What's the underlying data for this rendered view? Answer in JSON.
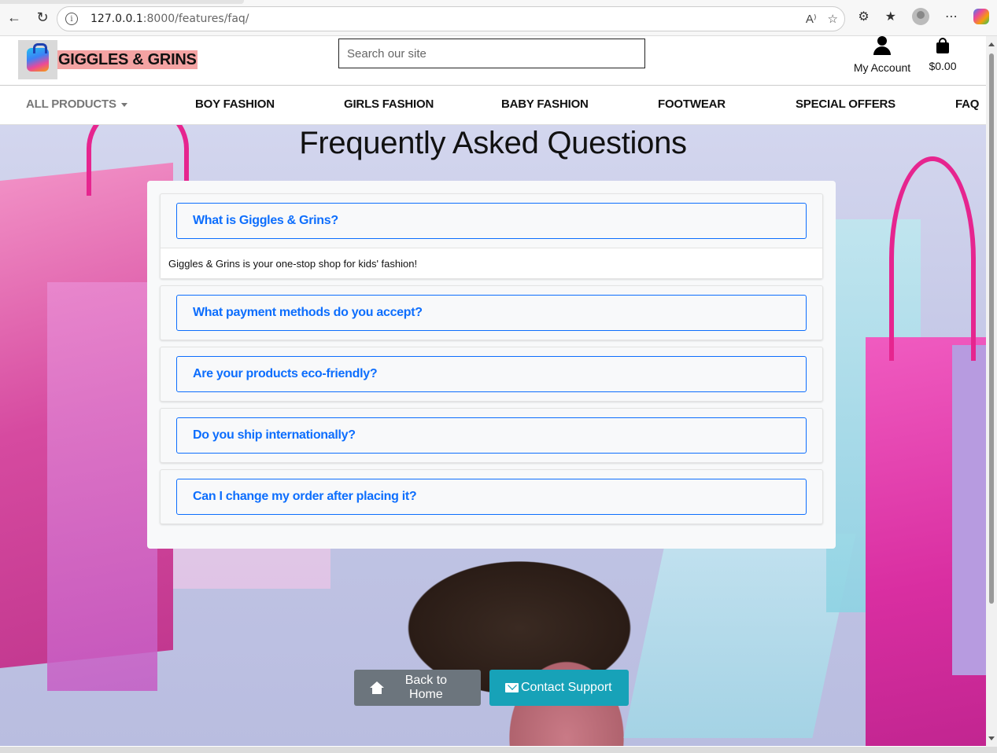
{
  "browser": {
    "url_host": "127.0.0.1",
    "url_path": ":8000/features/faq/"
  },
  "header": {
    "brand": "GIGGLES & GRINS",
    "search_placeholder": "Search our site",
    "account_label": "My Account",
    "cart_total": "$0.00"
  },
  "nav": {
    "items": [
      {
        "label": "ALL PRODUCTS"
      },
      {
        "label": "BOY FASHION"
      },
      {
        "label": "GIRLS FASHION"
      },
      {
        "label": "BABY FASHION"
      },
      {
        "label": "FOOTWEAR"
      },
      {
        "label": "SPECIAL OFFERS"
      },
      {
        "label": "FAQ"
      }
    ]
  },
  "page": {
    "title": "Frequently Asked Questions"
  },
  "faq": {
    "items": [
      {
        "question": "What is Giggles & Grins?",
        "answer": "Giggles & Grins is your one-stop shop for kids' fashion!"
      },
      {
        "question": "What payment methods do you accept?"
      },
      {
        "question": "Are your products eco-friendly?"
      },
      {
        "question": "Do you ship internationally?"
      },
      {
        "question": "Can I change my order after placing it?"
      }
    ]
  },
  "actions": {
    "back_home": "Back to Home",
    "contact_support": "Contact Support"
  },
  "colors": {
    "accent": "#0d6efd",
    "secondary_button": "#6c757d",
    "info_button": "#17a2b8",
    "brand_highlight": "#f4a3a3"
  }
}
